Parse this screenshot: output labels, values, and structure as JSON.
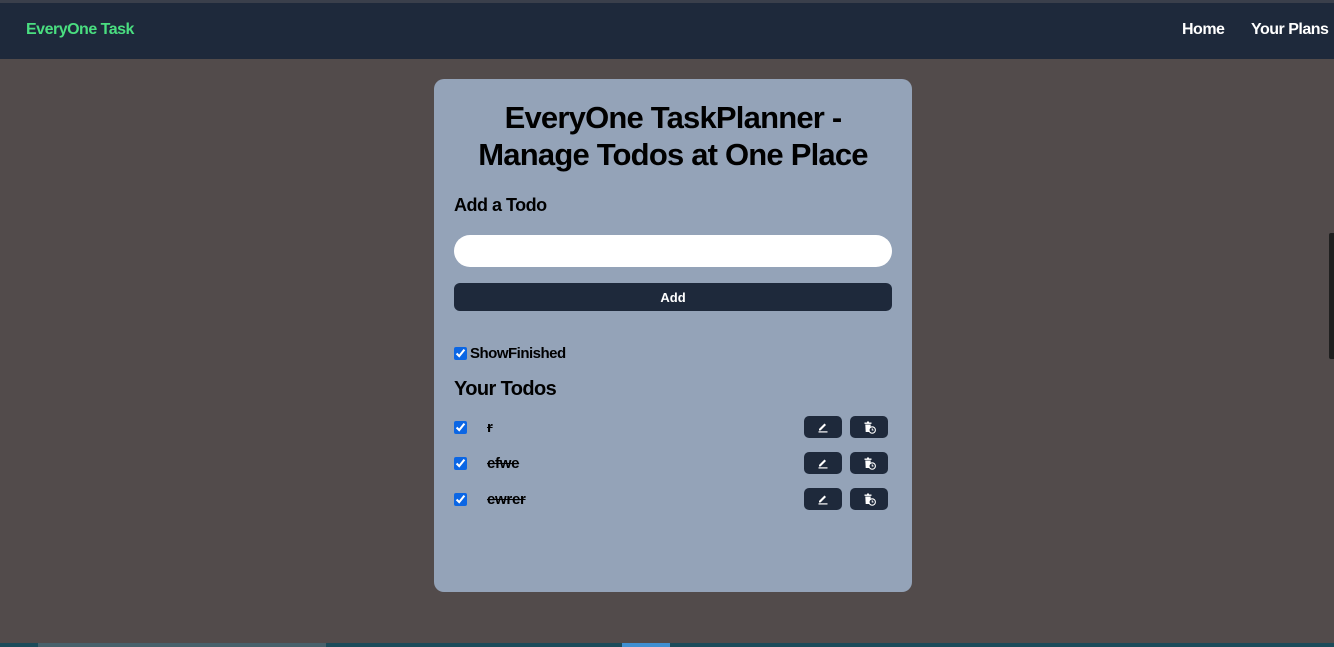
{
  "navbar": {
    "brand": "EveryOne Task",
    "links": [
      "Home",
      "Your Plans"
    ]
  },
  "main": {
    "title": "EveryOne TaskPlanner - Manage Todos at One Place",
    "add_heading": "Add a Todo",
    "input_value": "",
    "add_button": "Add",
    "show_finished_label": "ShowFinished",
    "show_finished_checked": true,
    "todos_heading": "Your Todos",
    "todos": [
      {
        "text": "r",
        "done": true
      },
      {
        "text": "efwe",
        "done": true
      },
      {
        "text": "ewrer",
        "done": true
      }
    ]
  },
  "icons": {
    "edit": "pencil-icon",
    "delete": "trash-icon"
  },
  "colors": {
    "page_bg": "#524b4b",
    "navbar_bg": "#1e293b",
    "brand": "#4ade80",
    "card_bg": "#94a3b8",
    "button_bg": "#1e293b",
    "checkbox": "#0b66e4"
  }
}
